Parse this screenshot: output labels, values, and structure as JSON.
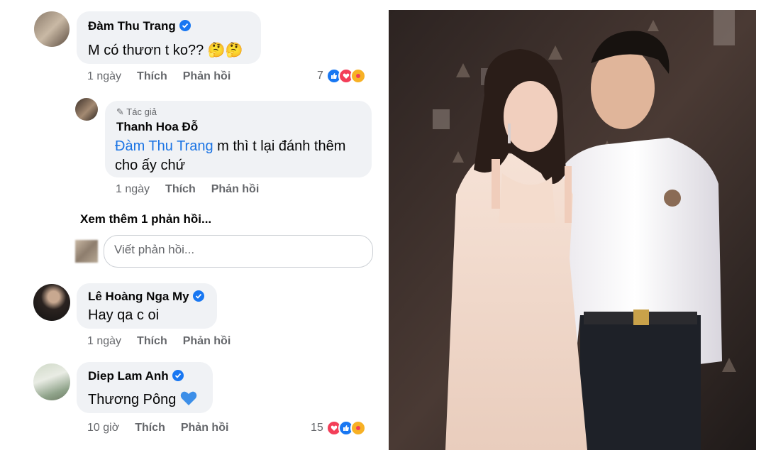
{
  "comments": [
    {
      "name": "Đàm Thu Trang",
      "text": "M có thươn t ko??",
      "time": "1 ngày",
      "like": "Thích",
      "reply": "Phản hồi",
      "reactions": "7"
    },
    {
      "author_badge": "Tác giả",
      "name": "Thanh Hoa Đỗ",
      "mention": "Đàm Thu Trang",
      "text_line1": " m thì t lại đánh thêm",
      "text_line2": "cho ấy chứ",
      "time": "1 ngày",
      "like": "Thích",
      "reply": "Phản hồi"
    },
    {
      "name": "Lê Hoàng Nga My",
      "text": "Hay qa c oi",
      "time": "1 ngày",
      "like": "Thích",
      "reply": "Phản hồi"
    },
    {
      "name": "Diep Lam Anh",
      "text": "Thương Pông",
      "time": "10 giờ",
      "like": "Thích",
      "reply": "Phản hồi",
      "reactions": "15"
    }
  ],
  "more_replies": "Xem thêm 1 phản hồi...",
  "reply_placeholder": "Viết phản hồi...",
  "colors": {
    "accent": "#1877f2",
    "bubble": "#f0f2f5",
    "secondary": "#65676b",
    "mention": "#1b74e4"
  }
}
